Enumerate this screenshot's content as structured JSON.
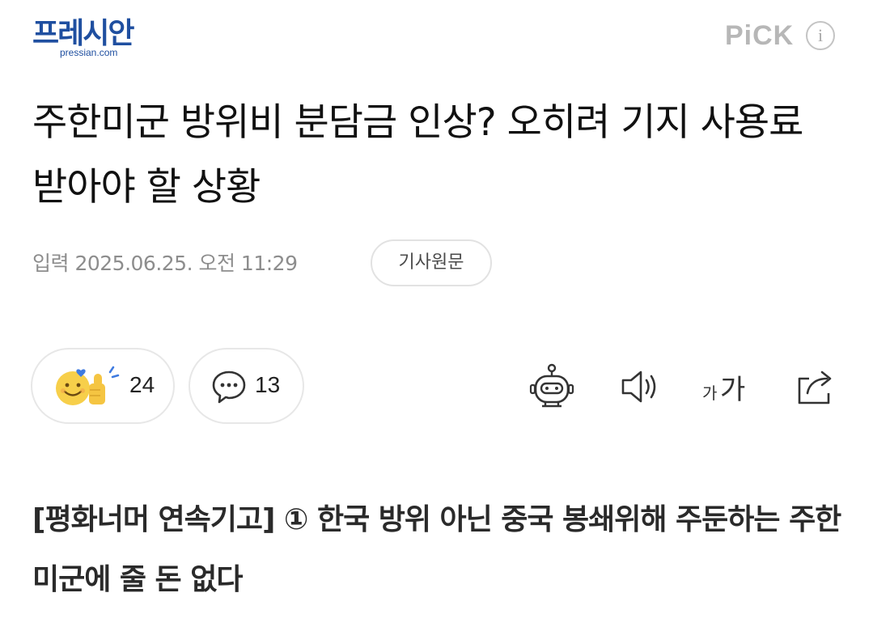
{
  "header": {
    "logo_main": "프레시안",
    "logo_sub": "pressian.com",
    "pick_label": "PiCK",
    "info_label": "i"
  },
  "article": {
    "title": "주한미군 방위비 분담금 인상? 오히려 기지 사용료 받아야 할 상황",
    "date": "입력 2025.06.25. 오전 11:29",
    "original_button": "기사원문",
    "subtitle": "[평화너머 연속기고] ① 한국 방위 아닌 중국 봉쇄위해 주둔하는 주한미군에 줄 돈 없다"
  },
  "actions": {
    "reaction_count": "24",
    "comment_count": "13",
    "font_small": "가",
    "font_big": "가"
  },
  "icons": {
    "reaction": "smile-like-emoji-icon",
    "comment": "speech-bubble-icon",
    "summary_bot": "robot-icon",
    "tts": "speaker-icon",
    "font_size": "font-size-icon",
    "share": "share-icon"
  },
  "colors": {
    "brand": "#1f4fa0",
    "pick": "#b7b7b7",
    "meta_text": "#8d8d8d",
    "pill_border": "#e7e7e7"
  }
}
